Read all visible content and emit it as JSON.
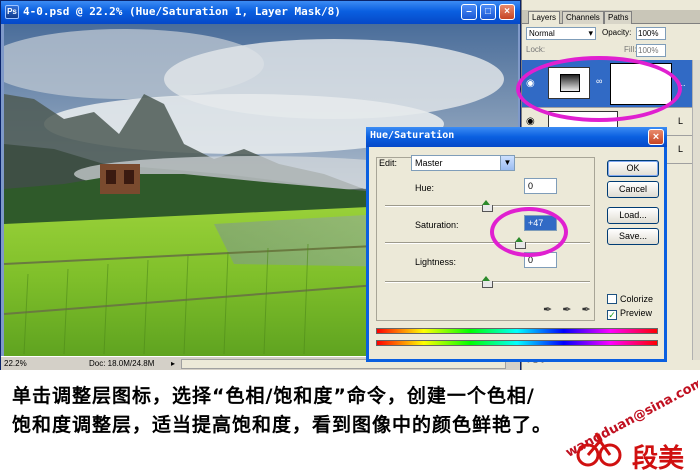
{
  "document": {
    "title": "4-0.psd @ 22.2% (Hue/Saturation 1, Layer Mask/8)",
    "zoom_status": "22.2%",
    "doc_status": "Doc: 18.0M/24.8M"
  },
  "layers_panel": {
    "tabs": [
      "Layers",
      "Channels",
      "Paths"
    ],
    "blend_mode": "Normal",
    "opacity_label": "Opacity:",
    "opacity_value": "100%",
    "lock_label": "Lock:",
    "fill_label": "Fill:",
    "fill_value": "100%"
  },
  "dialog": {
    "title": "Hue/Saturation",
    "edit_label": "Edit:",
    "edit_value": "Master",
    "hue_label": "Hue:",
    "hue_value": "0",
    "saturation_label": "Saturation:",
    "saturation_value": "+47",
    "lightness_label": "Lightness:",
    "lightness_value": "0",
    "buttons": {
      "ok": "OK",
      "cancel": "Cancel",
      "load": "Load...",
      "save": "Save..."
    },
    "colorize_label": "Colorize",
    "colorize_checked": false,
    "preview_label": "Preview",
    "preview_checked": true,
    "slider_positions": {
      "hue": 0,
      "saturation": 47,
      "lightness": 0,
      "range": [
        -100,
        100
      ]
    }
  },
  "caption": "单击调整层图标，选择“色相/饱和度”命令，创建一个色相/饱和度调整层，适当提高饱和度，看到图像中的颜色鲜艳了。",
  "watermark": {
    "text": "wangduan@sina.com",
    "logo_text": "段美"
  },
  "colors": {
    "highlight_ring": "#e020d0",
    "titlebar": "#0a5fe0",
    "panel_bg": "#ece9d8"
  }
}
